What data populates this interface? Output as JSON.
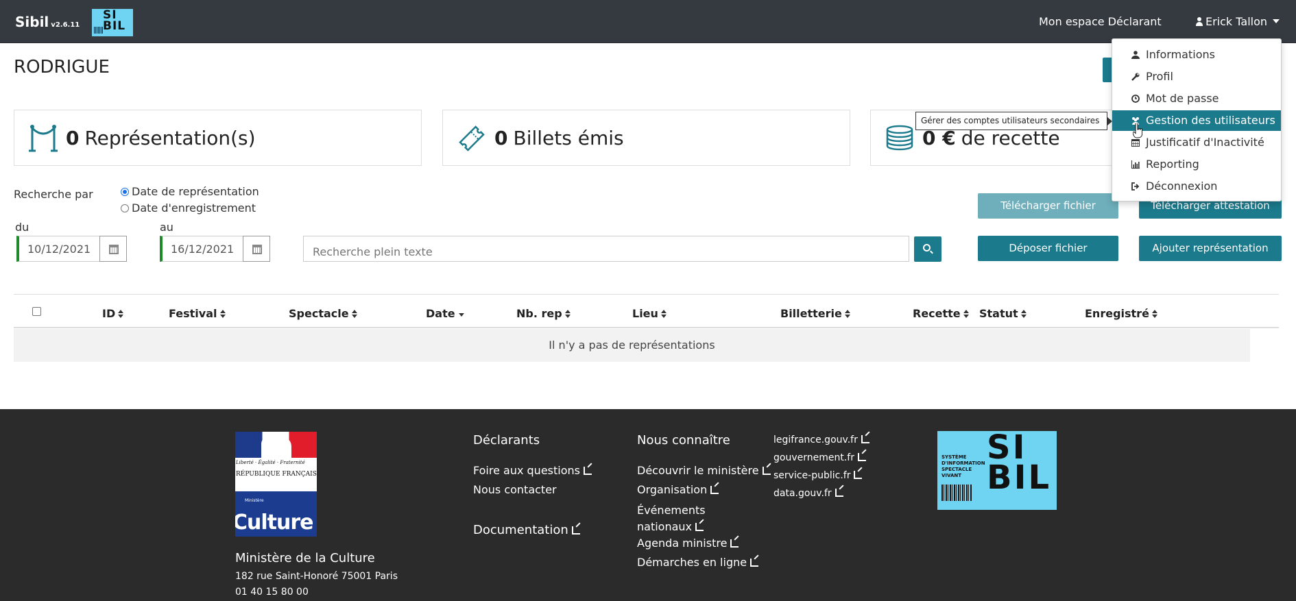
{
  "navbar": {
    "brand": "Sibil",
    "version": "v2.6.11",
    "logo_text": "SI BIL",
    "espace_link": "Mon espace Déclarant",
    "user_name": "Erick Tallon"
  },
  "page": {
    "title": "RODRIGUE"
  },
  "stats": [
    {
      "value": "0",
      "label": "Représentation(s)",
      "icon": "stanchion-icon"
    },
    {
      "value": "0",
      "label": "Billets émis",
      "icon": "ticket-icon"
    },
    {
      "value": "0 €",
      "label": "de recette",
      "icon": "coins-icon"
    }
  ],
  "search": {
    "label": "Recherche par",
    "radio_options": [
      "Date de représentation",
      "Date d'enregistrement"
    ],
    "selected_radio": "Date de représentation",
    "from_label": "du",
    "from_value": "10/12/2021",
    "to_label": "au",
    "to_value": "16/12/2021",
    "fulltext_placeholder": "Recherche plein texte"
  },
  "buttons": {
    "download_file": "Télécharger fichier",
    "download_certificate": "Télécharger attestation",
    "upload_file": "Déposer fichier",
    "add_representation": "Ajouter représentation"
  },
  "table": {
    "columns": [
      "ID",
      "Festival",
      "Spectacle",
      "Date",
      "Nb. rep",
      "Lieu",
      "Billetterie",
      "Recette",
      "Statut",
      "Enregistré"
    ],
    "empty_message": "Il n'y a pas de représentations"
  },
  "user_menu": {
    "items": [
      {
        "label": "Informations",
        "icon": "user-icon"
      },
      {
        "label": "Profil",
        "icon": "wrench-icon"
      },
      {
        "label": "Mot de passe",
        "icon": "clock-icon"
      },
      {
        "label": "Gestion des utilisateurs",
        "icon": "users-icon"
      },
      {
        "label": "Justificatif d'Inactivité",
        "icon": "calendar-icon"
      },
      {
        "label": "Reporting",
        "icon": "bar-chart-icon"
      },
      {
        "label": "Déconnexion",
        "icon": "sign-out-icon"
      }
    ],
    "active_item": "Gestion des utilisateurs",
    "tooltip": "Gérer des comptes utilisateurs secondaires"
  },
  "footer": {
    "rf_motto": "Liberté · Égalité · Fraternité",
    "rf_republique": "RÉPUBLIQUE FRANÇAISE",
    "rf_ministere": "Ministère",
    "rf_culture": "Culture",
    "ministry_name": "Ministère de la Culture",
    "address": "182 rue Saint-Honoré 75001 Paris",
    "phone": "01 40 15 80 00",
    "declarants_heading": "Déclarants",
    "declarants_links": [
      "Foire aux questions",
      "Nous contacter"
    ],
    "documentation": "Documentation",
    "know_us_heading": "Nous connaître",
    "know_us_links": [
      "Découvrir le ministère",
      "Organisation",
      "Événements nationaux",
      "Agenda ministre",
      "Démarches en ligne"
    ],
    "gov_links": [
      "legifrance.gouv.fr",
      "gouvernement.fr",
      "service-public.fr",
      "data.gouv.fr"
    ],
    "sibil_logo_small_text": "SYSTÈME D'INFORMATION SPECTACLE VIVANT",
    "sibil_logo_big": "SI BIL"
  },
  "colors": {
    "navbar": "#343a40",
    "accent": "#1b7a8c",
    "footer": "#2b2b2b",
    "sibil_blue": "#6fd3f2",
    "date_border": "#1e8a2c"
  }
}
